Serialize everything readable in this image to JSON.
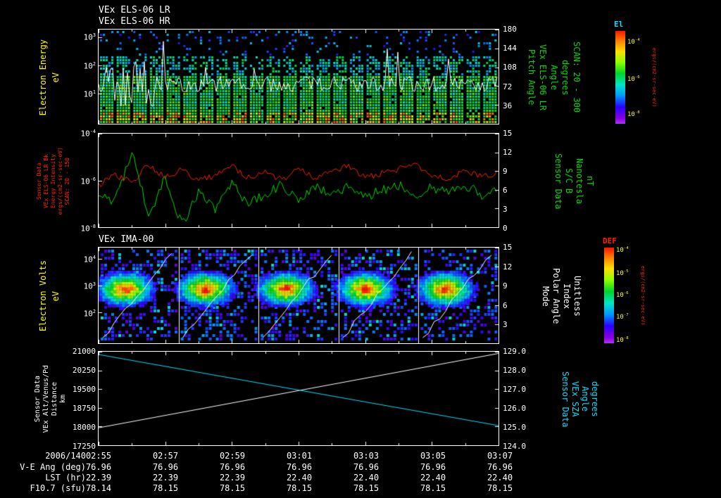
{
  "colors": {
    "background": "#000000",
    "white": "#ffffff",
    "yellow": "#ffff00",
    "green": "#00dd00",
    "red": "#ff2200",
    "cyan": "#00e0ff"
  },
  "titles": {
    "els_lr": "VEx ELS-06 LR",
    "els_hr": "VEx ELS-06 HR",
    "ima": "VEx IMA-00"
  },
  "panels": [
    {
      "id": "els-spectrogram",
      "left_title": {
        "lines": [
          "Electron Energy",
          "eV"
        ],
        "color": "#ffff00"
      },
      "left_ticks": [
        {
          "b": "10",
          "e": "3",
          "f": 0.08
        },
        {
          "b": "10",
          "e": "2",
          "f": 0.38
        },
        {
          "b": "10",
          "e": "1",
          "f": 0.68
        }
      ],
      "right_ticks": [
        {
          "t": "180",
          "f": 0
        },
        {
          "t": "144",
          "f": 0.2
        },
        {
          "t": "108",
          "f": 0.4
        },
        {
          "t": "72",
          "f": 0.6
        },
        {
          "t": "36",
          "f": 0.8
        }
      ],
      "right_title": {
        "lines": [
          "Pitch Angle",
          "VEx ELS-06 LR",
          "Angle",
          "degrees",
          "SCAN: 20 - 300"
        ],
        "color": "#00dd00"
      }
    },
    {
      "id": "intensity-lines",
      "left_title": {
        "lines": [
          "Sensor Data",
          "VEx ELS-06 LR Bk",
          "Energy Intensity",
          "ergs/(cm2-sr-sec-eV)",
          "SCAN: 20 - 150"
        ],
        "color": "#ff2200"
      },
      "left_ticks": [
        {
          "b": "10",
          "e": "-4",
          "f": 0
        },
        {
          "b": "10",
          "e": "-6",
          "f": 0.5
        },
        {
          "b": "10",
          "e": "-8",
          "f": 1
        }
      ],
      "right_ticks": [
        {
          "t": "15",
          "f": 0
        },
        {
          "t": "12",
          "f": 0.2
        },
        {
          "t": "9",
          "f": 0.4
        },
        {
          "t": "6",
          "f": 0.6
        },
        {
          "t": "3",
          "f": 0.8
        },
        {
          "t": "0",
          "f": 1
        }
      ],
      "right_title": {
        "lines": [
          "Sensor Data",
          "S/C B",
          "Nanotesla",
          "nT"
        ],
        "color": "#00dd00"
      }
    },
    {
      "id": "ima-spectrogram",
      "left_title": {
        "lines": [
          "Electron Volts",
          "eV"
        ],
        "color": "#ffff00"
      },
      "left_ticks": [
        {
          "b": "10",
          "e": "4",
          "f": 0.12
        },
        {
          "b": "10",
          "e": "3",
          "f": 0.4
        },
        {
          "b": "10",
          "e": "2",
          "f": 0.68
        }
      ],
      "right_ticks": [
        {
          "t": "15",
          "f": 0
        },
        {
          "t": "12",
          "f": 0.2
        },
        {
          "t": "9",
          "f": 0.4
        },
        {
          "t": "6",
          "f": 0.6
        },
        {
          "t": "3",
          "f": 0.8
        }
      ],
      "right_title": {
        "lines": [
          "Mode",
          "Polar Angle",
          "Index",
          "Unitless"
        ],
        "color": "#ffffff"
      }
    },
    {
      "id": "ephemeris-lines",
      "left_title": {
        "lines": [
          "Sensor Data",
          "VEx Alt/Venus/Pd",
          "Distance",
          "km"
        ],
        "color": "#ffffff"
      },
      "left_ticks": [
        {
          "t": "21000",
          "f": 0
        },
        {
          "t": "20250",
          "f": 0.2
        },
        {
          "t": "19500",
          "f": 0.4
        },
        {
          "t": "18750",
          "f": 0.6
        },
        {
          "t": "18000",
          "f": 0.8
        },
        {
          "t": "17250",
          "f": 1
        }
      ],
      "right_ticks": [
        {
          "t": "129.0",
          "f": 0
        },
        {
          "t": "128.0",
          "f": 0.2
        },
        {
          "t": "127.0",
          "f": 0.4
        },
        {
          "t": "126.0",
          "f": 0.6
        },
        {
          "t": "125.0",
          "f": 0.8
        },
        {
          "t": "124.0",
          "f": 1
        }
      ],
      "right_title": {
        "lines": [
          "Sensor Data",
          "VEx SZA",
          "Angle",
          "degrees"
        ],
        "color": "#00e0ff"
      }
    }
  ],
  "colorbars": [
    {
      "id": "els-colorbar",
      "label": "El",
      "label_color": "#00e0ff",
      "unit": "ergs/(cm2-sr-sec-eV)",
      "ticks": [
        {
          "e": "-4",
          "f": 0.12
        },
        {
          "e": "-6",
          "f": 0.52
        },
        {
          "e": "-8",
          "f": 0.9
        }
      ]
    },
    {
      "id": "ima-colorbar",
      "label": "DEF",
      "label_color": "#ff2200",
      "unit": "ergs/(cm2-sr-sec-eV)",
      "ticks": [
        {
          "e": "-4",
          "f": 0.03
        },
        {
          "e": "-5",
          "f": 0.27
        },
        {
          "e": "-6",
          "f": 0.5
        },
        {
          "e": "-7",
          "f": 0.73
        },
        {
          "e": "-8",
          "f": 0.97
        }
      ]
    }
  ],
  "chart_data": [
    {
      "type": "heatmap",
      "title": "VEx ELS-06 LR / VEx ELS-06 HR",
      "ylabel": "Electron Energy (eV)",
      "y_scale": "log",
      "y_ticks_eV": [
        10,
        100,
        1000
      ],
      "x_range_ut": [
        "02:55",
        "03:07"
      ],
      "sweep_columns": 24,
      "right_axis": {
        "label": "Pitch Angle VEx ELS-06 LR Angle degrees SCAN: 20 - 300",
        "range": [
          0,
          180
        ],
        "ticks": [
          36,
          72,
          108,
          144,
          180
        ]
      },
      "colorbar": {
        "label": "El",
        "unit": "ergs/(cm2-sr-sec-eV)",
        "tick_exponents": [
          -4,
          -6,
          -8
        ]
      },
      "overlay": "white pitch-angle trace near 60% panel height with narrow upward spikes, largest at left edge",
      "description": "Periodic energy-sweep columns; bulk flux green/cyan between ~5-300 eV, sparse blue counts at higher energies, occasional yellow-red cells at lowest energies."
    },
    {
      "type": "line",
      "ylabel": "VEx ELS-06 LR Bk Energy Intensity ergs/(cm2-sr-sec-eV)",
      "y_scale": "log",
      "ylim_log10": [
        -8,
        -4
      ],
      "right_axis": {
        "label": "Sensor Data S/C B Nanotesla nT",
        "ylim": [
          0,
          15
        ],
        "ticks": [
          0,
          3,
          6,
          9,
          12,
          15
        ]
      },
      "x_minutes_after_0255": [
        0,
        0.5,
        1,
        1.5,
        2,
        2.5,
        3,
        3.5,
        4,
        4.5,
        5,
        5.5,
        6,
        6.5,
        7,
        7.5,
        8,
        8.5,
        9,
        9.5,
        10,
        10.5,
        11,
        11.5,
        12
      ],
      "series": [
        {
          "name": "ELS-06 LR Bk Energy Intensity",
          "color": "#ff2200",
          "log10_values": [
            -6.2,
            -5.8,
            -6.1,
            -5.3,
            -5.9,
            -5.5,
            -6.0,
            -5.8,
            -5.4,
            -5.9,
            -5.6,
            -6.0,
            -5.5,
            -5.9,
            -5.6,
            -5.4,
            -5.9,
            -5.7,
            -5.5,
            -5.3,
            -5.8,
            -5.9,
            -5.6,
            -5.8,
            -5.7
          ]
        },
        {
          "name": "S/C B",
          "color": "#00dd00",
          "log10_values": [
            -6.5,
            -6.9,
            -4.7,
            -7.5,
            -5.9,
            -7.9,
            -6.5,
            -7.3,
            -6.1,
            -7.0,
            -6.6,
            -6.2,
            -6.8,
            -6.3,
            -6.6,
            -6.2,
            -6.7,
            -6.4,
            -6.2,
            -6.6,
            -6.3,
            -6.5,
            -6.2,
            -6.6,
            -6.4
          ]
        }
      ]
    },
    {
      "type": "heatmap",
      "title": "VEx IMA-00",
      "ylabel": "Electron Volts (eV)",
      "y_scale": "log",
      "y_ticks_eV": [
        100,
        1000,
        10000
      ],
      "subpanels": 5,
      "right_axis": {
        "label": "Mode Polar Angle Index Unitless",
        "range": [
          0,
          15
        ],
        "ticks": [
          3,
          6,
          9,
          12,
          15
        ]
      },
      "colorbar": {
        "label": "DEF",
        "unit": "ergs/(cm2-sr-sec-eV)",
        "tick_exponents": [
          -4,
          -5,
          -6,
          -7,
          -8
        ]
      },
      "description": "Five IMA scan frames separated by white vertical lines; each frame holds an intense red/yellow ion population near 1e3 eV with green/blue halo, scattered blue counts, and a stepped white diagonal scan line rising left-to-right."
    },
    {
      "type": "line",
      "ylabel": "Sensor Data VEx Alt/Venus/Pd Distance (km)",
      "ylim": [
        17250,
        21000
      ],
      "right_axis": {
        "label": "Sensor Data VEx SZA Angle (degrees)",
        "ylim": [
          124,
          129
        ]
      },
      "series": [
        {
          "name": "Altitude",
          "color": "#ffffff",
          "axis": "left",
          "x_frac": [
            0,
            1
          ],
          "values": [
            17950,
            20930
          ]
        },
        {
          "name": "SZA",
          "color": "#00e0ff",
          "axis": "right",
          "x_frac": [
            0,
            1
          ],
          "values": [
            128.85,
            125.05
          ]
        }
      ]
    }
  ],
  "footer": {
    "date": "2006/140",
    "times": [
      "02:55",
      "02:57",
      "02:59",
      "03:01",
      "03:03",
      "03:05",
      "03:07"
    ],
    "rows": [
      {
        "label": "V-E Ang (deg)",
        "values": [
          "76.96",
          "76.96",
          "76.96",
          "76.96",
          "76.96",
          "76.96",
          "76.96"
        ]
      },
      {
        "label": "LST (hr)",
        "values": [
          "22.39",
          "22.39",
          "22.39",
          "22.40",
          "22.40",
          "22.40",
          "22.40"
        ]
      },
      {
        "label": "F10.7 (sfu)",
        "values": [
          "78.14",
          "78.15",
          "78.15",
          "78.15",
          "78.15",
          "78.15",
          "78.15"
        ]
      }
    ]
  }
}
